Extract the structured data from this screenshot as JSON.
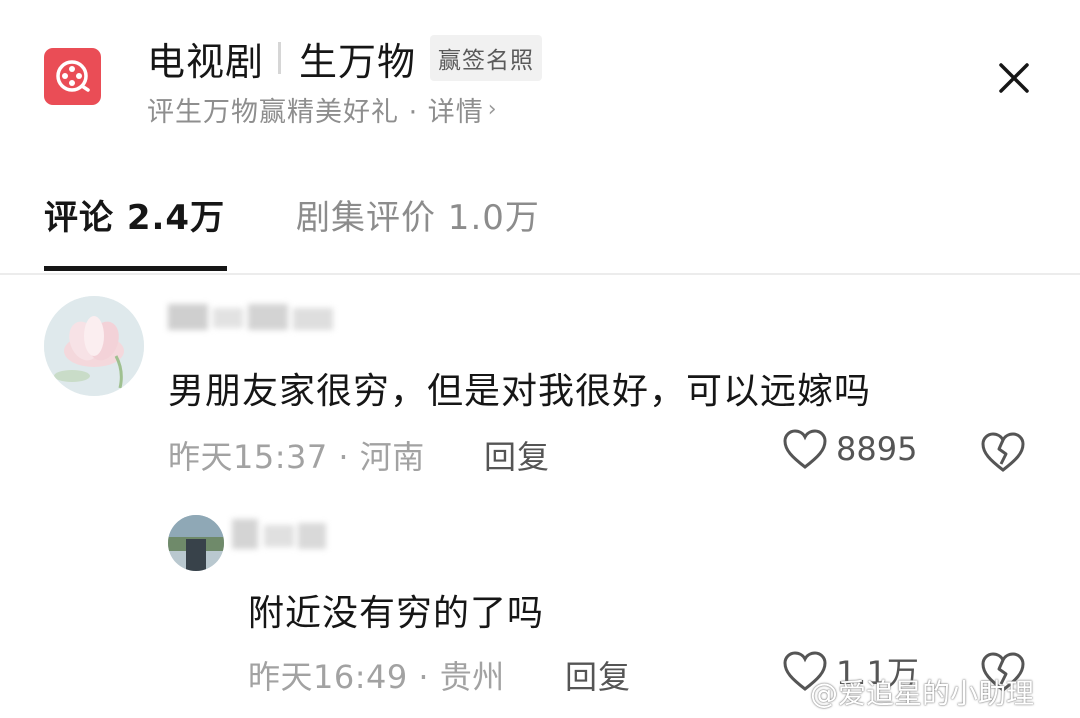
{
  "header": {
    "title": "电视剧",
    "subtitle_title": "生万物",
    "badge": "赢签名照",
    "promo_text": "评生万物赢精美好礼 · 详情",
    "promo_chevron": "›",
    "icon_color": "#ea4d56"
  },
  "tabs": [
    {
      "label": "评论 2.4万",
      "active": true
    },
    {
      "label": "剧集评价 1.0万",
      "active": false
    }
  ],
  "comments": [
    {
      "text": "男朋友家很穷，但是对我很好，可以远嫁吗",
      "time_location": "昨天15:37 · 河南",
      "reply_label": "回复",
      "likes": "8895"
    }
  ],
  "replies": [
    {
      "text": "附近没有穷的了吗",
      "time_location": "昨天16:49 · 贵州",
      "reply_label": "回复",
      "likes": "1.1万"
    }
  ],
  "watermark": "@爱追星的小助理",
  "icons": {
    "app": "film-reel-icon",
    "close": "close-icon",
    "like": "heart-outline-icon",
    "dislike": "broken-heart-icon"
  }
}
